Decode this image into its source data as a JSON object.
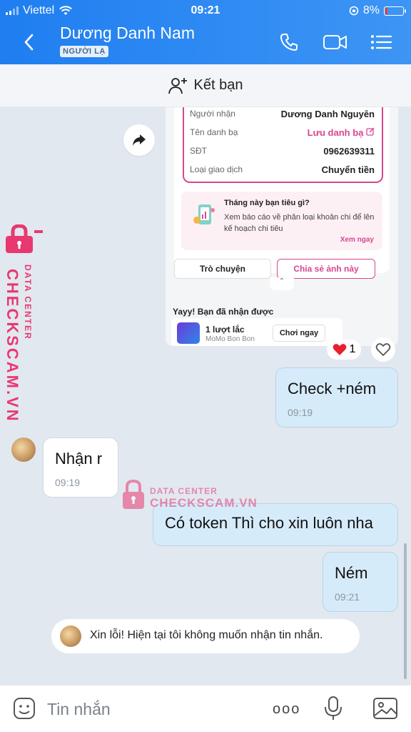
{
  "status": {
    "carrier": "Viettel",
    "time": "09:21",
    "battery": "8%"
  },
  "header": {
    "name": "Dương Danh Nam",
    "tag": "NGƯỜI LẠ"
  },
  "addbar": {
    "label": "Kết bạn"
  },
  "card": {
    "rows": [
      {
        "key": "Người nhận",
        "value": "Dương Danh Nguyên"
      },
      {
        "key": "Tên danh bạ",
        "value": "Lưu danh bạ"
      },
      {
        "key": "SĐT",
        "value": "0962639311"
      },
      {
        "key": "Loại giao dịch",
        "value": "Chuyển tiền"
      }
    ],
    "promo_title": "Tháng này bạn tiêu gì?",
    "promo_desc": "Xem báo cáo về phân loại khoản chi để lên kế hoạch chi tiêu",
    "promo_link": "Xem ngay",
    "btn_chat": "Trò chuyện",
    "btn_share": "Chia sẻ ảnh này",
    "yay": "Yayy! Bạn đã nhận được",
    "reward_title": "1 lượt lắc",
    "reward_sub": "MoMo Bon Bon",
    "reward_btn": "Chơi ngay"
  },
  "reaction": {
    "count": "1"
  },
  "messages": [
    {
      "from": "me",
      "text": "Check +ném",
      "time": "09:19"
    },
    {
      "from": "them",
      "text": "Nhận r",
      "time": "09:19"
    },
    {
      "from": "me",
      "text": "Có token Thì cho xin luôn nha"
    },
    {
      "from": "me",
      "text": "Ném",
      "time": "09:21"
    }
  ],
  "notice": "Xin lỗi! Hiện tại tôi không muốn nhận tin nhắn.",
  "watermark": {
    "line1": "DATA CENTER",
    "line2": "CHECKSCAM.VN"
  },
  "input": {
    "placeholder": "Tin nhắn",
    "more": "ooo"
  },
  "colors": {
    "header": "#2a86f2",
    "accent_pink": "#d7478f",
    "watermark": "#e83870"
  },
  "icons": [
    "back-chevron-icon",
    "phone-icon",
    "video-call-icon",
    "menu-list-icon",
    "add-user-icon",
    "share-forward-icon",
    "heart-icon",
    "sticker-icon",
    "mic-icon",
    "image-icon"
  ]
}
